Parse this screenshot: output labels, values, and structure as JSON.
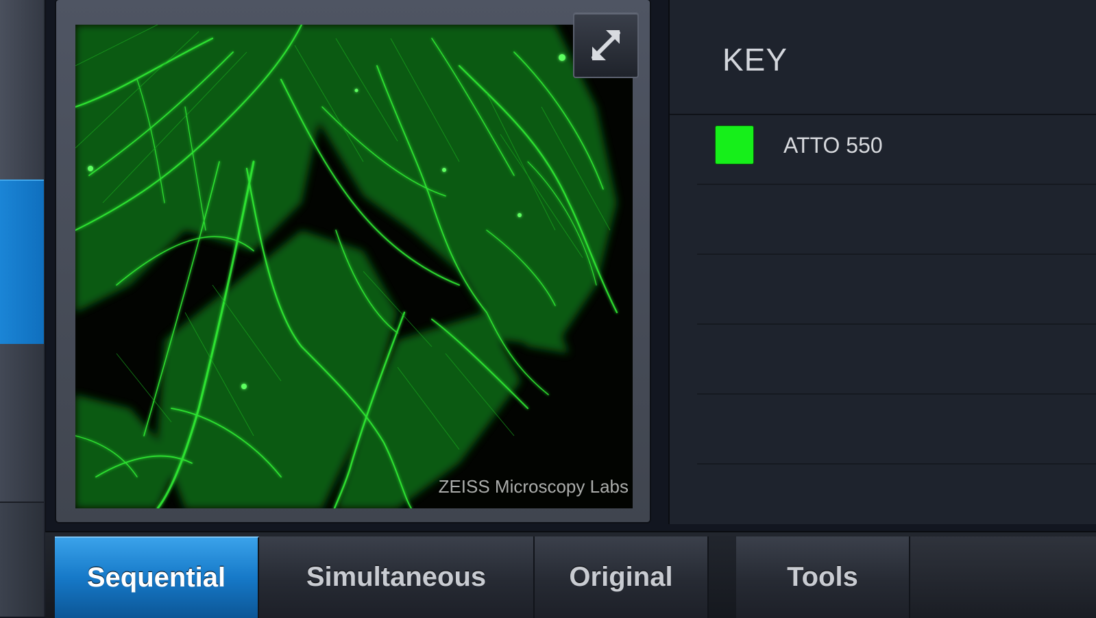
{
  "viewer": {
    "watermark": "ZEISS Microscopy Labs",
    "expand_icon": "expand-arrows-icon"
  },
  "key": {
    "title": "KEY",
    "items": [
      {
        "label": "ATTO 550",
        "color": "#16ef1a"
      }
    ],
    "empty_rows": 4
  },
  "tabs": [
    {
      "label": "Sequential",
      "active": true
    },
    {
      "label": "Simultaneous",
      "active": false
    },
    {
      "label": "Original",
      "active": false
    },
    {
      "label": "Tools",
      "active": false
    }
  ],
  "colors": {
    "accent": "#1679c8",
    "fluorescence": "#22e02a"
  }
}
